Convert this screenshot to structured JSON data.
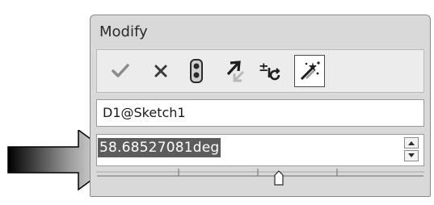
{
  "dialog": {
    "title": "Modify",
    "toolbar": {
      "buttons": [
        {
          "icon": "checkmark-icon"
        },
        {
          "icon": "close-icon"
        },
        {
          "icon": "traffic-light-icon"
        },
        {
          "icon": "rebuild-icon"
        },
        {
          "icon": "reverse-dimension-icon"
        },
        {
          "icon": "mark-dimension-icon",
          "active": true
        }
      ]
    },
    "name_field": {
      "value": "D1@Sketch1"
    },
    "value_field": {
      "value": "58.68527081deg"
    },
    "thumbwheel": {
      "position": 0.5
    }
  },
  "colors": {
    "dialog_bg": "#d9d9d9",
    "selection_bg": "#5c5c5c",
    "arrow_dark": "#000000",
    "arrow_light": "#ffffff"
  }
}
